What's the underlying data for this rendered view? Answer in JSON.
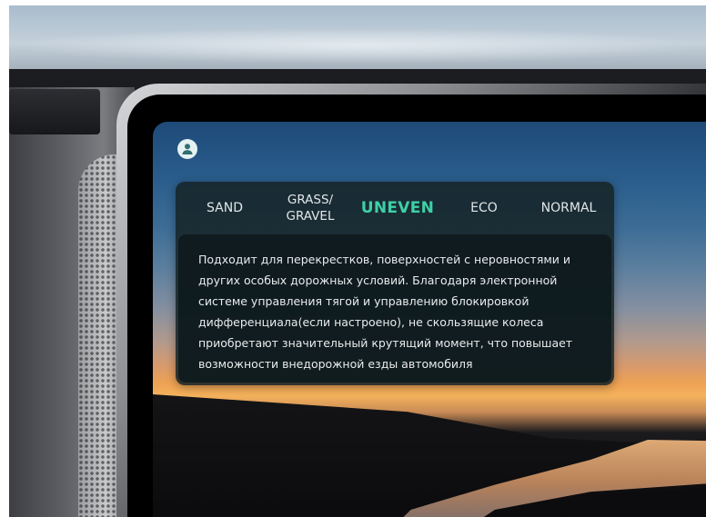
{
  "profile": {
    "icon": "user-icon",
    "accent_color": "#e6f2f1"
  },
  "drive_modes": {
    "tabs": [
      {
        "label": "SAND",
        "selected": false
      },
      {
        "label": "GRASS/\nGRAVEL",
        "selected": false
      },
      {
        "label": "UNEVEN",
        "selected": true
      },
      {
        "label": "ECO",
        "selected": false
      },
      {
        "label": "NORMAL",
        "selected": false
      }
    ],
    "selected_color": "#3fd0a6",
    "description": "Подходит для перекрестков, поверхностей с неровностями и других особых дорожных условий. Благодаря электронной системе управления тягой и управлению блокировкой дифференциала(если настроено), не скользящие колеса приобретают значительный крутящий момент, что повышает возможности внедорожной езды автомобиля"
  }
}
